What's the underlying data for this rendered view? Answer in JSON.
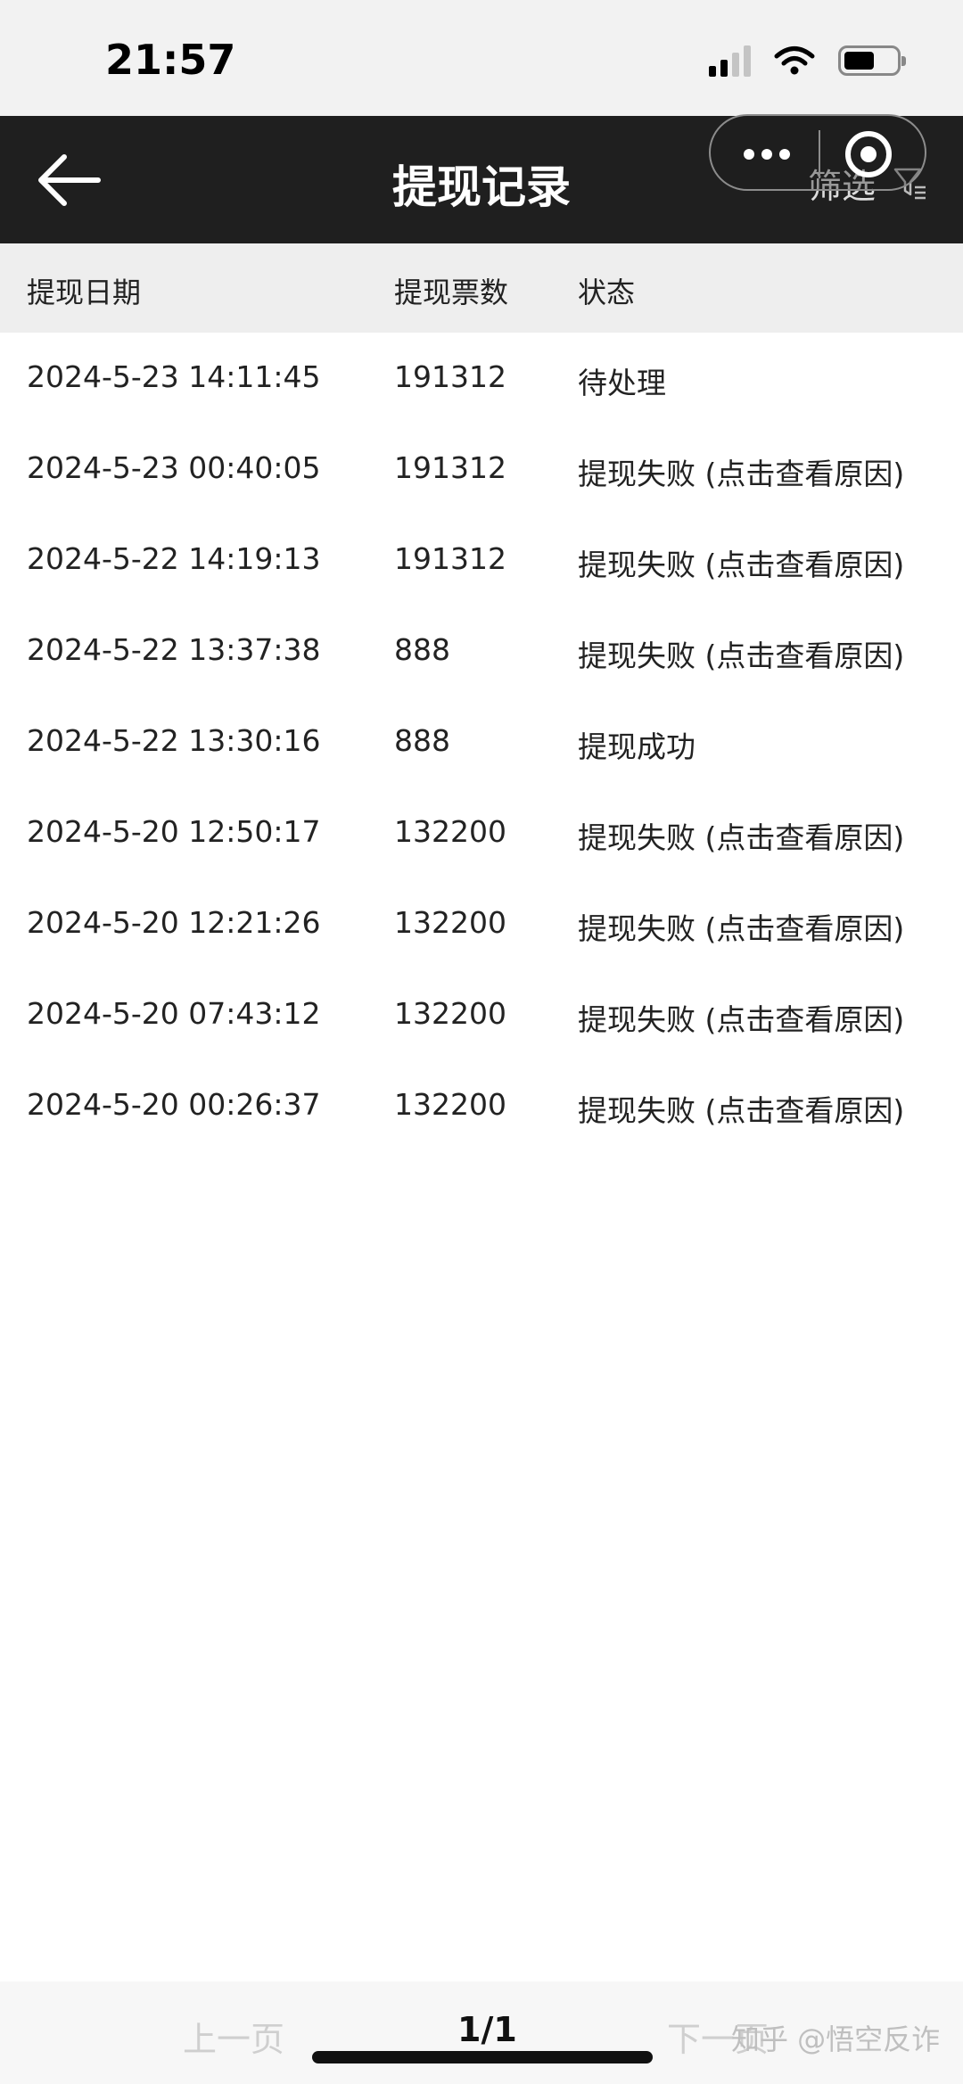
{
  "status_bar": {
    "time": "21:57",
    "icons": [
      "signal-icon",
      "wifi-icon",
      "battery-icon"
    ],
    "battery_level_fraction": 0.5
  },
  "nav": {
    "title": "提现记录",
    "filter_label": "筛选",
    "icons": [
      "back-arrow-icon",
      "more-dots-icon",
      "target-icon",
      "filter-icon"
    ]
  },
  "table": {
    "headers": {
      "date": "提现日期",
      "amount": "提现票数",
      "status": "状态"
    },
    "rows": [
      {
        "date": "2024-5-23 14:11:45",
        "amount": "191312",
        "status": "待处理",
        "status_type": "pending"
      },
      {
        "date": "2024-5-23 00:40:05",
        "amount": "191312",
        "status": "提现失败 (点击查看原因)",
        "status_type": "failed"
      },
      {
        "date": "2024-5-22 14:19:13",
        "amount": "191312",
        "status": "提现失败 (点击查看原因)",
        "status_type": "failed"
      },
      {
        "date": "2024-5-22 13:37:38",
        "amount": "888",
        "status": "提现失败 (点击查看原因)",
        "status_type": "failed"
      },
      {
        "date": "2024-5-22 13:30:16",
        "amount": "888",
        "status": "提现成功",
        "status_type": "success"
      },
      {
        "date": "2024-5-20 12:50:17",
        "amount": "132200",
        "status": "提现失败 (点击查看原因)",
        "status_type": "failed"
      },
      {
        "date": "2024-5-20 12:21:26",
        "amount": "132200",
        "status": "提现失败 (点击查看原因)",
        "status_type": "failed"
      },
      {
        "date": "2024-5-20 07:43:12",
        "amount": "132200",
        "status": "提现失败 (点击查看原因)",
        "status_type": "failed"
      },
      {
        "date": "2024-5-20 00:26:37",
        "amount": "132200",
        "status": "提现失败 (点击查看原因)",
        "status_type": "failed"
      }
    ]
  },
  "pager": {
    "prev_label": "上一页",
    "page_indicator": "1/1",
    "next_label": "下一页"
  },
  "watermark": "知乎 @悟空反诈",
  "colors": {
    "nav_background": "#1f1f1f",
    "failed": "#d9262c",
    "success": "#1a8a1a",
    "header_background": "#eeeeee"
  }
}
